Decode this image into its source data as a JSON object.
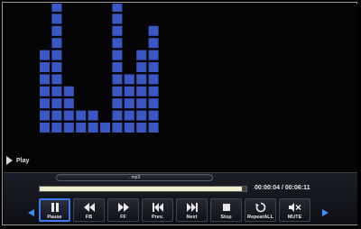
{
  "visualizer": {
    "bar_color": "#3a57c4",
    "levels": [
      7,
      11,
      4,
      2,
      2,
      1,
      11,
      5,
      7,
      9
    ]
  },
  "status": {
    "label": "Play"
  },
  "filename": ". mp3",
  "progress": {
    "fraction": 0.98,
    "fill_color": "#efecd0"
  },
  "time": {
    "elapsed": "00:00:04",
    "total": "00:06:11",
    "display": "00:00:04 / 00:06:11"
  },
  "controls": [
    {
      "label": "Pause",
      "icon": "pause-icon"
    },
    {
      "label": "FB",
      "icon": "fast-backward-icon"
    },
    {
      "label": "FF",
      "icon": "fast-forward-icon"
    },
    {
      "label": "Prev.",
      "icon": "previous-icon"
    },
    {
      "label": "Next",
      "icon": "next-icon"
    },
    {
      "label": "Stop",
      "icon": "stop-icon"
    },
    {
      "label": "RepeatALL",
      "icon": "repeat-icon"
    },
    {
      "label": "MUTE",
      "icon": "mute-icon"
    }
  ],
  "accent_color": "#3d7bf0"
}
